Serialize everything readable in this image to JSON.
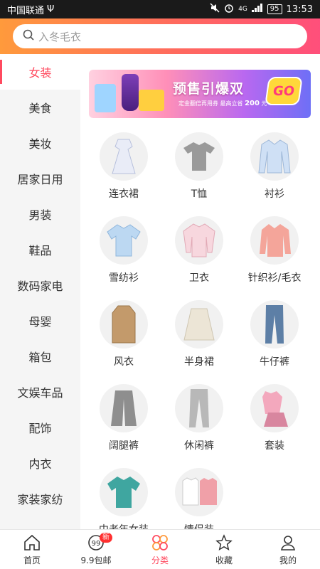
{
  "status_bar": {
    "carrier": "中国联通",
    "usb_symbol": "Ψ",
    "network": "4G",
    "battery": "95",
    "time": "13:53"
  },
  "search": {
    "placeholder": "入冬毛衣"
  },
  "sidebar": {
    "items": [
      {
        "label": "女装",
        "active": true
      },
      {
        "label": "美食"
      },
      {
        "label": "美妆"
      },
      {
        "label": "居家日用"
      },
      {
        "label": "男装"
      },
      {
        "label": "鞋品"
      },
      {
        "label": "数码家电"
      },
      {
        "label": "母婴"
      },
      {
        "label": "箱包"
      },
      {
        "label": "文娱车品"
      },
      {
        "label": "配饰"
      },
      {
        "label": "内衣"
      },
      {
        "label": "家装家纺"
      }
    ]
  },
  "banner": {
    "title": "预售引爆双",
    "subtitle_prefix": "定金翻倍再用券  最高立省",
    "amount": "200",
    "unit": "元",
    "cta": "GO"
  },
  "categories": [
    {
      "label": "连衣裙",
      "icon": "dress-icon",
      "color": "#e9ecf7"
    },
    {
      "label": "T恤",
      "icon": "tshirt-icon",
      "color": "#9a9a9a"
    },
    {
      "label": "衬衫",
      "icon": "shirt-icon",
      "color": "#cfe0f5"
    },
    {
      "label": "雪纺衫",
      "icon": "chiffon-blouse-icon",
      "color": "#bcd8f2"
    },
    {
      "label": "卫衣",
      "icon": "hoodie-icon",
      "color": "#f7d7de"
    },
    {
      "label": "针织衫/毛衣",
      "icon": "cardigan-icon",
      "color": "#f4a59a"
    },
    {
      "label": "风衣",
      "icon": "trench-coat-icon",
      "color": "#c39a6b"
    },
    {
      "label": "半身裙",
      "icon": "skirt-icon",
      "color": "#ece5d6"
    },
    {
      "label": "牛仔裤",
      "icon": "jeans-icon",
      "color": "#5d7fa6"
    },
    {
      "label": "阔腿裤",
      "icon": "wide-leg-pants-icon",
      "color": "#8e8e8e"
    },
    {
      "label": "休闲裤",
      "icon": "casual-pants-icon",
      "color": "#b8b8b8"
    },
    {
      "label": "套装",
      "icon": "suit-set-icon",
      "color": "#f3a8bd"
    },
    {
      "label": "中老年女装",
      "icon": "middle-aged-wear-icon",
      "color": "#3fa6a0"
    },
    {
      "label": "情侣装",
      "icon": "couple-wear-icon",
      "color": "#f0a0a8"
    }
  ],
  "tabbar": {
    "items": [
      {
        "label": "首页",
        "icon": "home-icon"
      },
      {
        "label": "9.9包邮",
        "icon": "nine-nine-icon",
        "badge": "新"
      },
      {
        "label": "分类",
        "icon": "category-icon",
        "active": true
      },
      {
        "label": "收藏",
        "icon": "star-icon"
      },
      {
        "label": "我的",
        "icon": "user-icon"
      }
    ]
  },
  "colors": {
    "accent": "#ff4a5f",
    "header_start": "#ff9a3c",
    "header_end": "#ff4f7b"
  }
}
